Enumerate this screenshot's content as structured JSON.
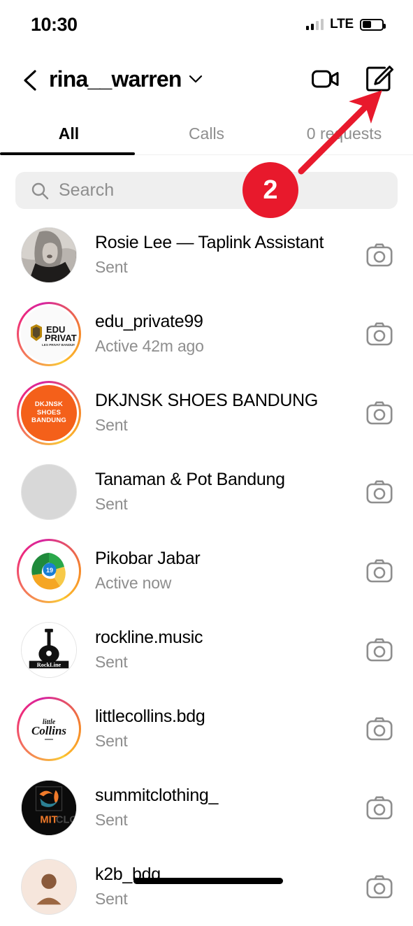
{
  "status_bar": {
    "time": "10:30",
    "network": "LTE",
    "signal_bars_filled": 2,
    "signal_bars_total": 4,
    "battery_percent": 45
  },
  "header": {
    "username": "rina__warren",
    "back_icon": "chevron-left-icon",
    "dropdown_icon": "chevron-down-icon",
    "video_call_icon": "video-camera-icon",
    "compose_icon": "compose-edit-icon"
  },
  "tabs": [
    {
      "label": "All",
      "active": true
    },
    {
      "label": "Calls",
      "active": false
    },
    {
      "label": "0 requests",
      "active": false
    }
  ],
  "search": {
    "placeholder": "Search",
    "value": "",
    "icon": "search-icon"
  },
  "chats": [
    {
      "name": "Rosie Lee — Taplink Assistant",
      "status": "Sent",
      "ring": false,
      "avatar_style": "av-rosie",
      "avatar_text": "",
      "action_icon": "camera-icon"
    },
    {
      "name": "edu_private99",
      "status": "Active 42m ago",
      "ring": true,
      "avatar_style": "av-edu",
      "avatar_text": "EDU PRIVAT",
      "action_icon": "camera-icon"
    },
    {
      "name": "DKJNSK SHOES BANDUNG",
      "status": "Sent",
      "ring": true,
      "avatar_style": "av-dkjnsk",
      "avatar_text": "DKJNSK SHOES BANDUNG",
      "action_icon": "camera-icon"
    },
    {
      "name": "Tanaman & Pot Bandung",
      "status": "Sent",
      "ring": false,
      "avatar_style": "av-plain",
      "avatar_text": "",
      "action_icon": "camera-icon"
    },
    {
      "name": "Pikobar Jabar",
      "status": "Active now",
      "ring": true,
      "avatar_style": "av-piko",
      "avatar_text": "",
      "action_icon": "camera-icon"
    },
    {
      "name": "rockline.music",
      "status": "Sent",
      "ring": false,
      "avatar_style": "av-rock",
      "avatar_text": "",
      "action_icon": "camera-icon"
    },
    {
      "name": "littlecollins.bdg",
      "status": "Sent",
      "ring": true,
      "avatar_style": "av-collins",
      "avatar_text": "",
      "action_icon": "camera-icon"
    },
    {
      "name": "summitclothing_",
      "status": "Sent",
      "ring": false,
      "avatar_style": "av-summit",
      "avatar_text": "",
      "action_icon": "camera-icon"
    },
    {
      "name": "k2b_bdg",
      "status": "Sent",
      "ring": false,
      "avatar_style": "av-k2b",
      "avatar_text": "",
      "action_icon": "camera-icon"
    }
  ],
  "annotation": {
    "badge_label": "2",
    "badge_color": "#e8192c",
    "arrow_color": "#e8192c",
    "arrow_points_to": "compose-edit-icon"
  }
}
